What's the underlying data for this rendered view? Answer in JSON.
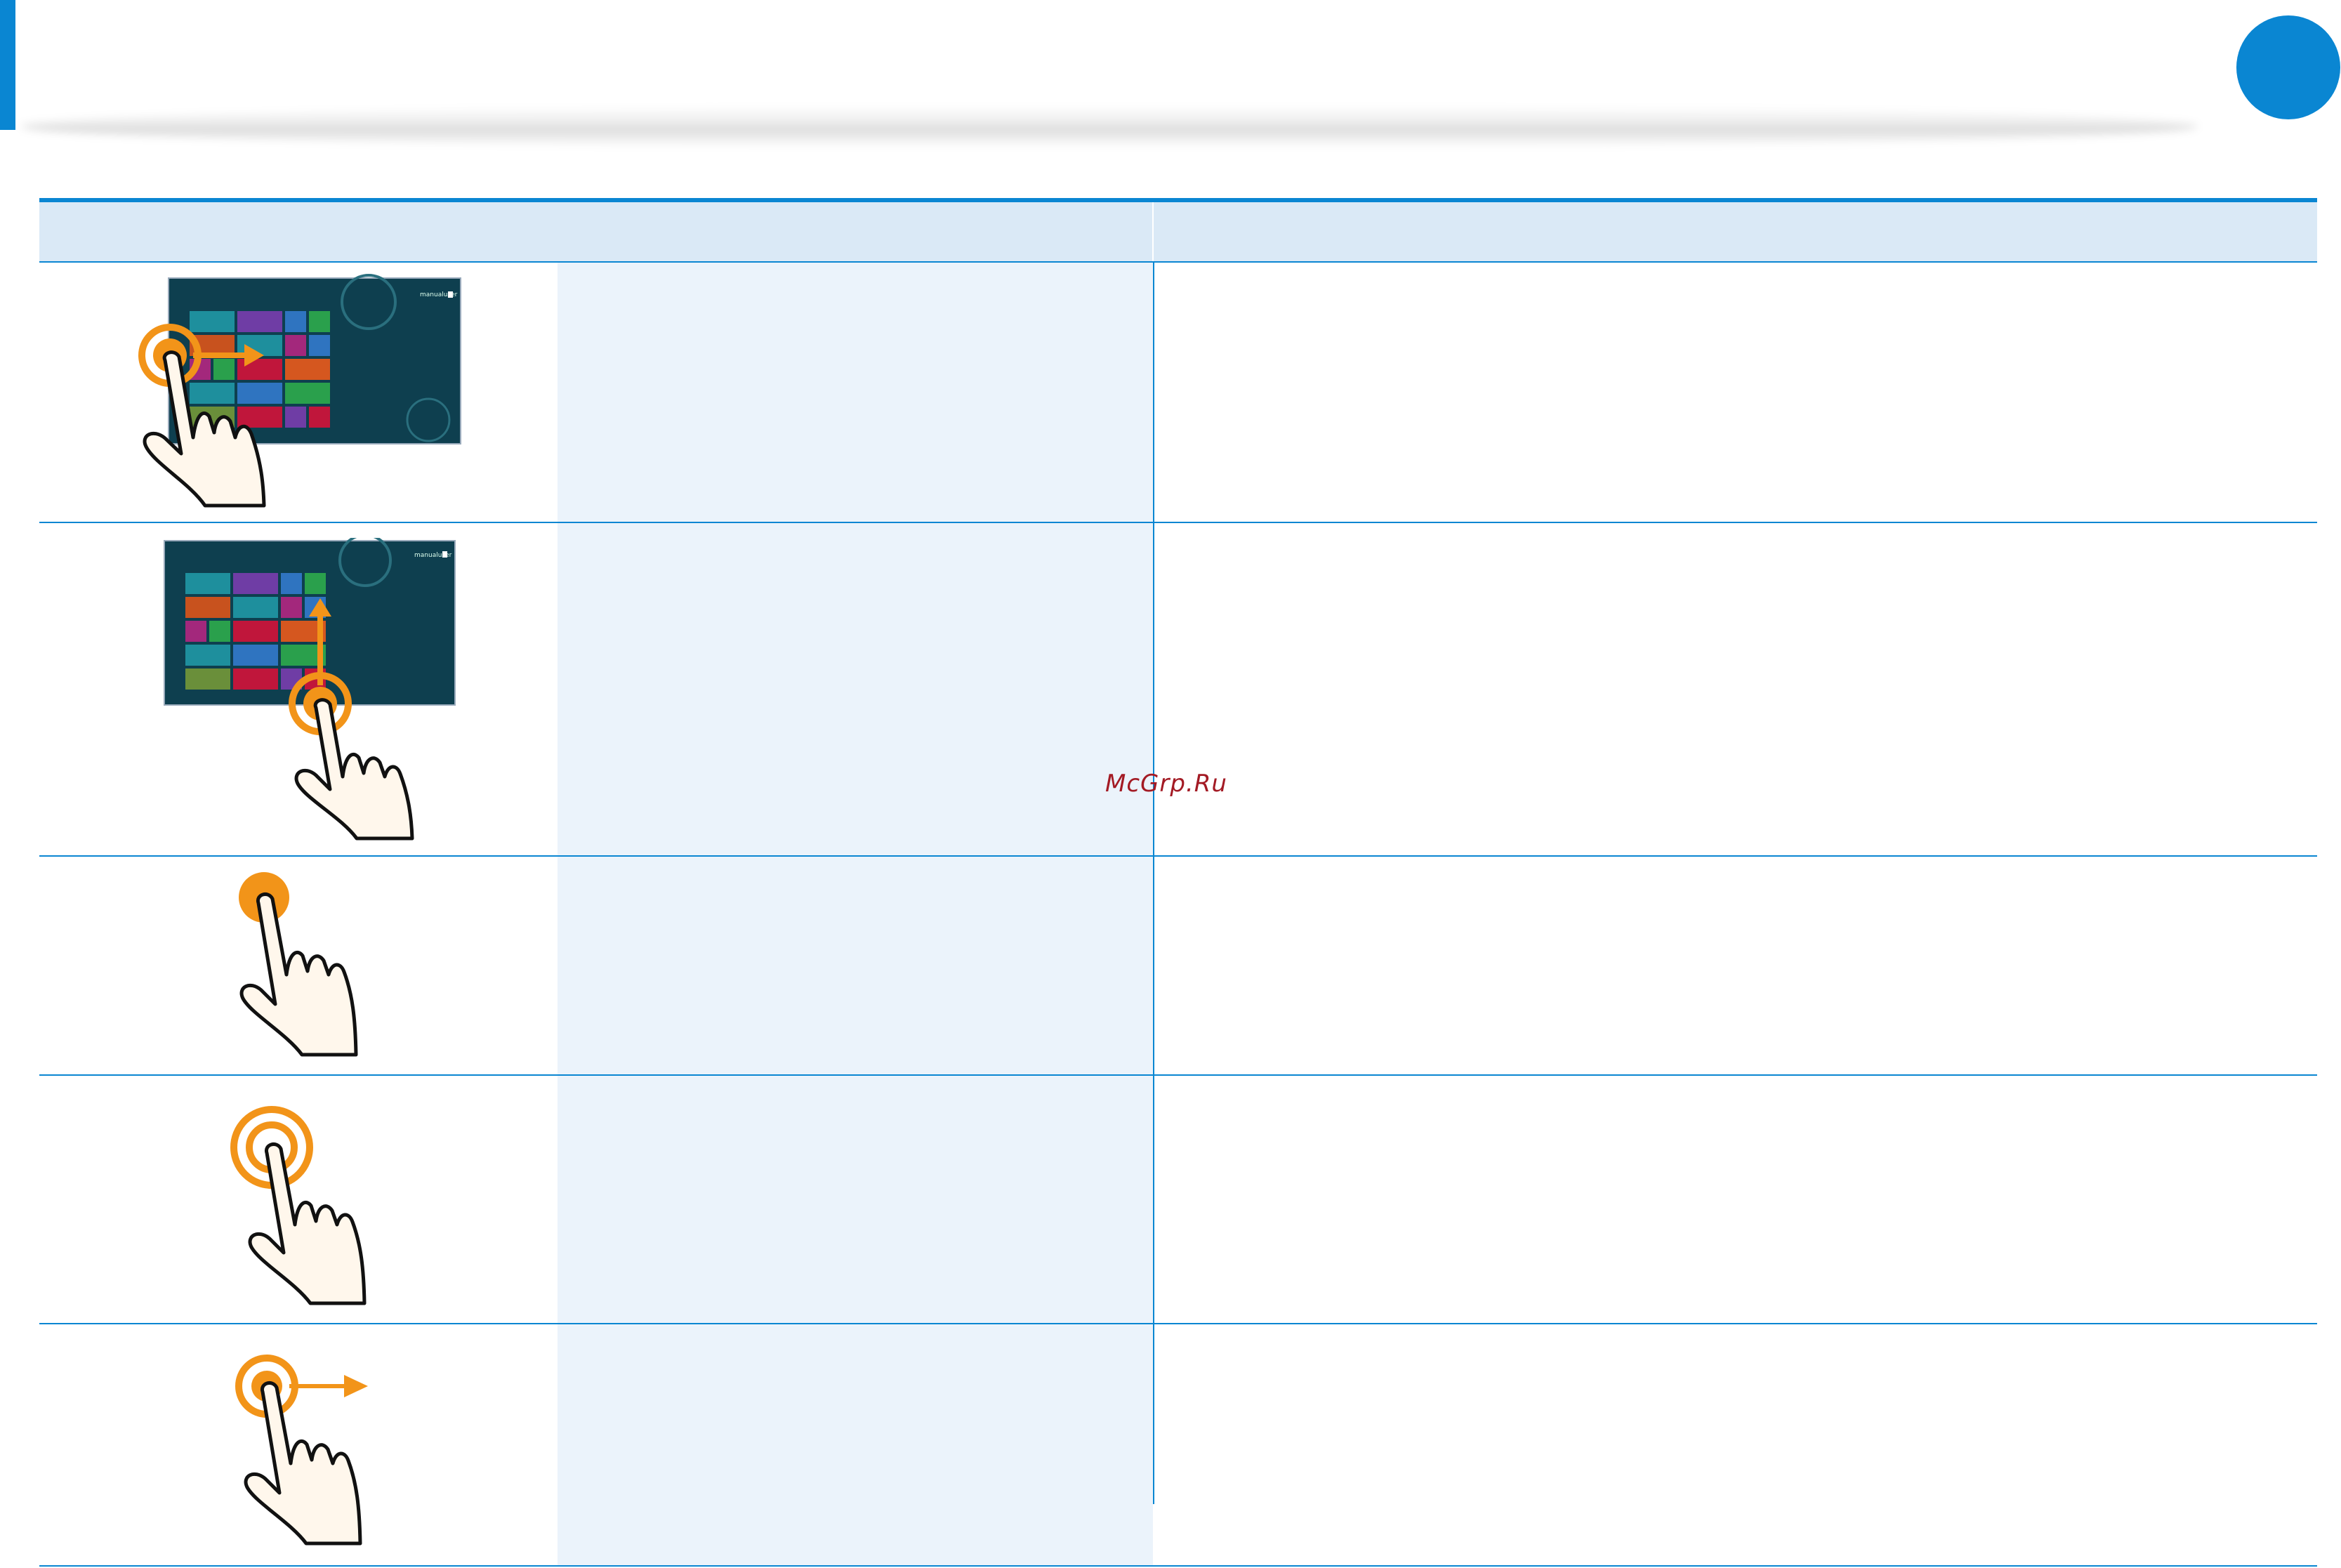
{
  "watermark": "McGrp.Ru",
  "screen": {
    "username": "manualuser"
  },
  "colors": {
    "accent": "#0a86d2",
    "header_band": "#dae9f6",
    "desc_column": "#ebf3fb",
    "gesture_orange": "#f29419",
    "start_screen_bg": "#0e3f4f",
    "hand_fill": "#fff7ec",
    "watermark": "#a31a24"
  },
  "gestures": [
    {
      "name": "swipe-right-on-start-screen",
      "icon": "swipe-right-hand-icon"
    },
    {
      "name": "swipe-up-on-start-screen",
      "icon": "swipe-up-hand-icon"
    },
    {
      "name": "tap",
      "icon": "tap-hand-icon"
    },
    {
      "name": "double-tap",
      "icon": "double-tap-hand-icon"
    },
    {
      "name": "tap-and-slide",
      "icon": "slide-hand-icon"
    }
  ]
}
